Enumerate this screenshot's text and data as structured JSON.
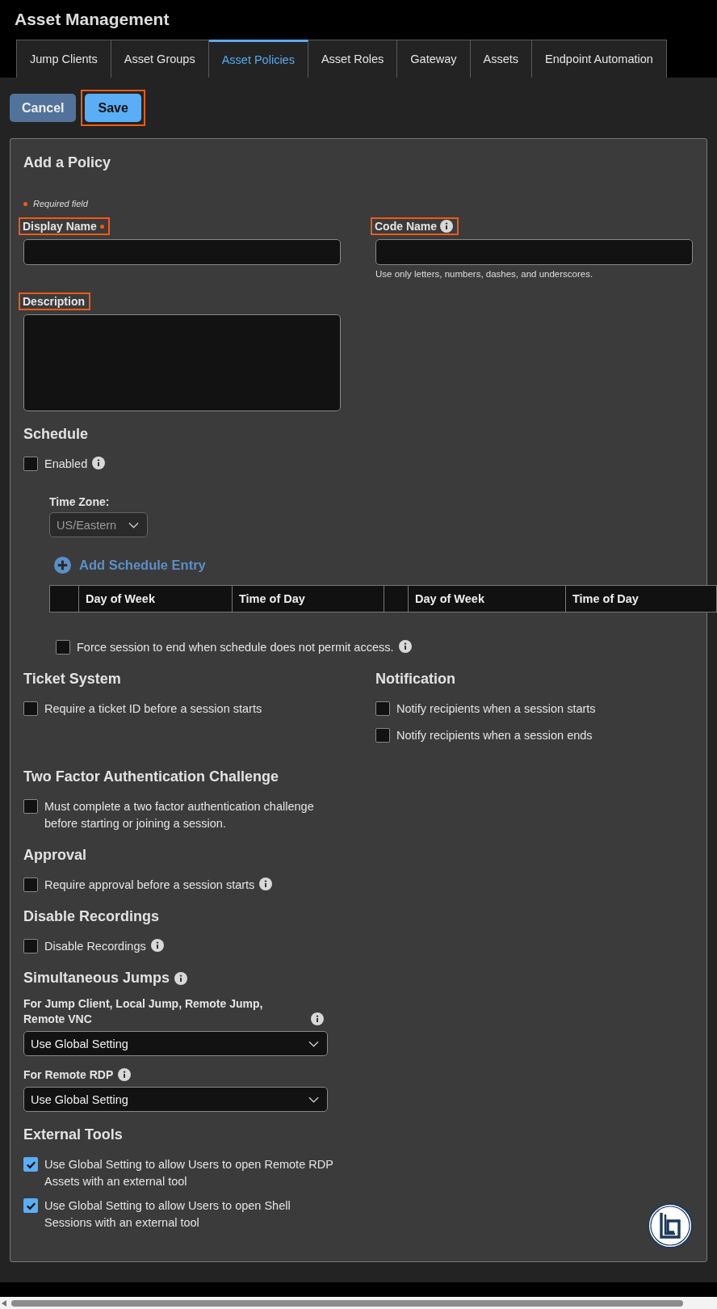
{
  "header": {
    "title": "Asset Management"
  },
  "tabs": [
    {
      "label": "Jump Clients",
      "selected": false
    },
    {
      "label": "Asset Groups",
      "selected": false
    },
    {
      "label": "Asset Policies",
      "selected": true
    },
    {
      "label": "Asset Roles",
      "selected": false
    },
    {
      "label": "Gateway",
      "selected": false
    },
    {
      "label": "Assets",
      "selected": false
    },
    {
      "label": "Endpoint Automation",
      "selected": false
    }
  ],
  "buttons": [
    {
      "label": "Cancel",
      "kind": "secondary",
      "highlighted": false
    },
    {
      "label": "Save",
      "kind": "primary",
      "highlighted": true
    }
  ],
  "form": {
    "title": "Add a Policy",
    "required_note": "Required field",
    "display_name": {
      "label": "Display Name",
      "required": true,
      "info": false,
      "highlighted": true
    },
    "code_name": {
      "label": "Code Name",
      "required": false,
      "info": true,
      "highlighted": true,
      "hint": "Use only letters, numbers, dashes, and underscores."
    },
    "description": {
      "label": "Description",
      "highlighted": true
    },
    "schedule": {
      "title": "Schedule",
      "enabled": {
        "label": "Enabled",
        "checked": false,
        "info": true
      },
      "time_zone": {
        "label": "Time Zone:",
        "value": "US/Eastern",
        "disabled": true
      },
      "add_entry": "Add Schedule Entry",
      "columns": [
        {
          "kind": "blank"
        },
        {
          "kind": "text",
          "label": "Day of Week"
        },
        {
          "kind": "text",
          "label": "Time of Day"
        },
        {
          "kind": "blank"
        },
        {
          "kind": "text",
          "label": "Day of Week"
        },
        {
          "kind": "text",
          "label": "Time of Day"
        }
      ],
      "force_end": {
        "label": "Force session to end when schedule does not permit access.",
        "checked": false,
        "info": true
      }
    },
    "ticket_system": {
      "title": "Ticket System",
      "options": [
        {
          "label": "Require a ticket ID before a session starts",
          "checked": false,
          "info": false
        }
      ]
    },
    "notification": {
      "title": "Notification",
      "options": [
        {
          "label": "Notify recipients when a session starts",
          "checked": false,
          "info": false
        },
        {
          "label": "Notify recipients when a session ends",
          "checked": false,
          "info": false
        }
      ]
    },
    "two_factor": {
      "title": "Two Factor Authentication Challenge",
      "options": [
        {
          "label": "Must complete a two factor authentication challenge before starting or joining a session.",
          "checked": false,
          "info": false
        }
      ]
    },
    "approval": {
      "title": "Approval",
      "options": [
        {
          "label": "Require approval before a session starts",
          "checked": false,
          "info": true
        }
      ]
    },
    "disable_recordings": {
      "title": "Disable Recordings",
      "options": [
        {
          "label": "Disable Recordings",
          "checked": false,
          "info": true
        }
      ]
    },
    "simultaneous_jumps": {
      "title": "Simultaneous Jumps",
      "info": true,
      "selects": [
        {
          "label": "For Jump Client, Local Jump, Remote Jump, Remote VNC",
          "info": true,
          "value": "Use Global Setting"
        },
        {
          "label": "For Remote RDP",
          "info": true,
          "value": "Use Global Setting"
        }
      ]
    },
    "external_tools": {
      "title": "External Tools",
      "options": [
        {
          "label": "Use Global Setting to allow Users to open Remote RDP Assets with an external tool",
          "checked": true,
          "info": false
        },
        {
          "label": "Use Global Setting to allow Users to open Shell Sessions with an external tool",
          "checked": true,
          "info": false
        }
      ]
    }
  }
}
